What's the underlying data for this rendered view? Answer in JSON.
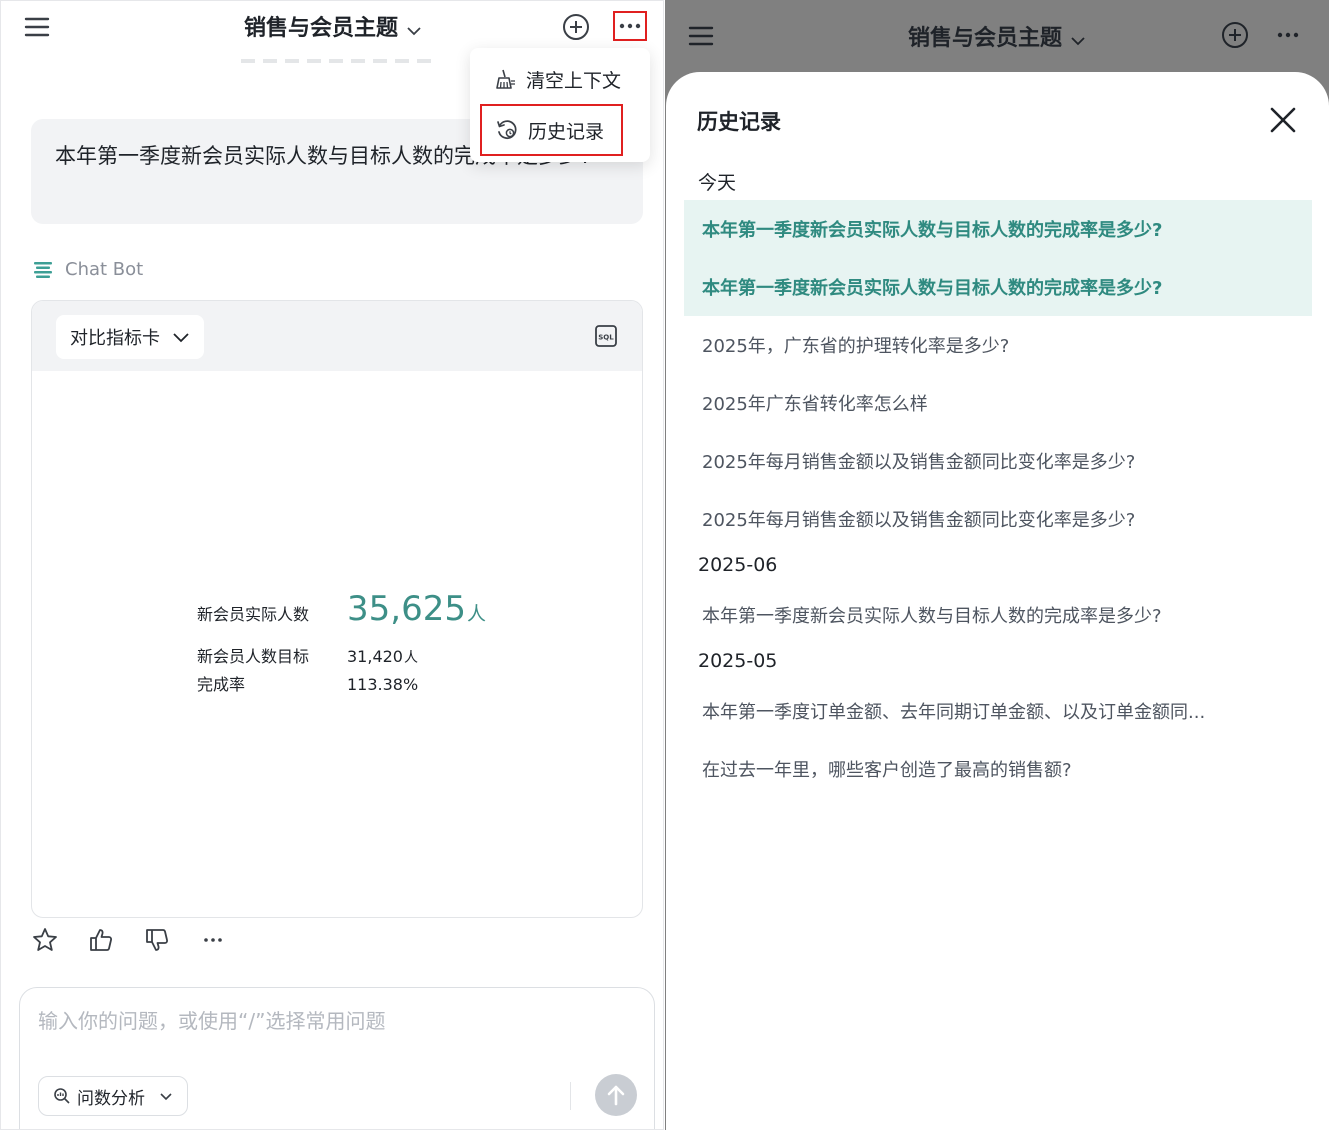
{
  "left": {
    "header": {
      "title": "销售与会员主题"
    },
    "question": "本年第一季度新会员实际人数与目标人数的完成率是多少?",
    "bot_name": "Chat Bot",
    "card": {
      "select_label": "对比指标卡",
      "metrics": [
        {
          "label": "新会员实际人数",
          "value": "35,625",
          "unit": "人"
        },
        {
          "label": "新会员人数目标",
          "value": "31,420",
          "unit": "人"
        },
        {
          "label": "完成率",
          "value": "113.38%"
        }
      ]
    },
    "input": {
      "placeholder": "输入你的问题，或使用“/”选择常用问题",
      "mode_label": "问数分析"
    },
    "dropdown": {
      "clear_label": "清空上下文",
      "history_label": "历史记录"
    }
  },
  "right": {
    "header": {
      "title": "销售与会员主题"
    },
    "sheet": {
      "title": "历史记录",
      "groups": [
        {
          "label": "今天"
        },
        {
          "label": "2025-06"
        },
        {
          "label": "2025-05"
        }
      ],
      "items": [
        "本年第一季度新会员实际人数与目标人数的完成率是多少?",
        "本年第一季度新会员实际人数与目标人数的完成率是多少?",
        "2025年，广东省的护理转化率是多少?",
        "2025年广东省转化率怎么样",
        "2025年每月销售金额以及销售金额同比变化率是多少?",
        "2025年每月销售金额以及销售金额同比变化率是多少?",
        "本年第一季度新会员实际人数与目标人数的完成率是多少?",
        "本年第一季度订单金额、去年同期订单金额、以及订单金额同...",
        "在过去一年里，哪些客户创造了最高的销售额?"
      ]
    }
  },
  "colors": {
    "accent_teal": "#3d8f87",
    "highlight_bg": "#e7f4f2",
    "annotation_red": "#e02020"
  },
  "icons": [
    "hamburger-icon",
    "chevron-down-icon",
    "plus-circle-icon",
    "more-icon",
    "broom-icon",
    "history-icon",
    "bot-icon",
    "sql-icon",
    "star-icon",
    "thumbs-up-icon",
    "thumbs-down-icon",
    "search-data-icon",
    "send-icon",
    "close-icon"
  ]
}
